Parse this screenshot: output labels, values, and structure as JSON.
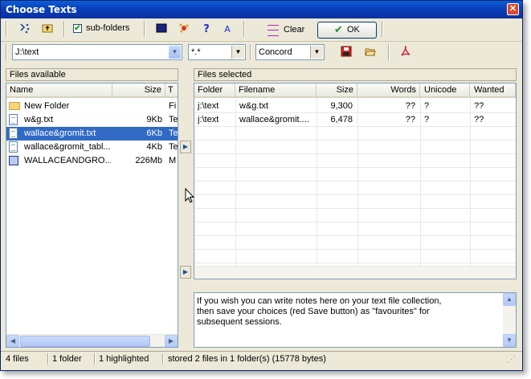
{
  "window": {
    "title": "Choose Texts",
    "close": "✕"
  },
  "toolbar": {
    "subfolders_label": "sub-folders",
    "subfolders_checked": true,
    "help_glyph": "?",
    "font_glyph": "A",
    "clear_label": "Clear",
    "ok_label": "OK",
    "path_value": "J:\\text",
    "filter_value": "*.*",
    "tool_value": "Concord",
    "arrow_glyph": "▼"
  },
  "left_panel": {
    "title": "Files available",
    "columns": [
      "Name",
      "Size",
      "T"
    ],
    "rows": [
      {
        "icon": "folder-icon",
        "name": "New Folder",
        "size": "",
        "type": "Fi",
        "selected": false
      },
      {
        "icon": "text-file-icon",
        "name": "w&g.txt",
        "size": "9Kb",
        "type": "Te",
        "selected": false
      },
      {
        "icon": "text-file-icon",
        "name": "wallace&gromit.txt",
        "size": "6Kb",
        "type": "Te",
        "selected": true
      },
      {
        "icon": "text-file-icon",
        "name": "wallace&gromit_tabl...",
        "size": "4Kb",
        "type": "Te",
        "selected": false
      },
      {
        "icon": "video-file-icon",
        "name": "WALLACEANDGRO...",
        "size": "226Mb",
        "type": "M",
        "selected": false
      }
    ]
  },
  "right_panel": {
    "title": "Files selected",
    "columns": [
      "Folder",
      "Filename",
      "Size",
      "Words",
      "Unicode",
      "Wanted"
    ],
    "rows": [
      {
        "folder": "j:\\text",
        "filename": "w&g.txt",
        "size": "9,300",
        "words": "??",
        "unicode": "?",
        "wanted": "??"
      },
      {
        "folder": "j:\\text",
        "filename": "wallace&gromit....",
        "size": "6,478",
        "words": "??",
        "unicode": "?",
        "wanted": "??"
      }
    ],
    "notes": "If you wish you can write notes here on your text file collection,\nthen save your choices (red Save button) as \"favourites\" for\nsubsequent sessions."
  },
  "statusbar": {
    "files": "4 files",
    "folders": "1 folder",
    "highlighted": "1 highlighted",
    "stored": "stored 2 files in 1 folder(s) (15778 bytes)"
  }
}
